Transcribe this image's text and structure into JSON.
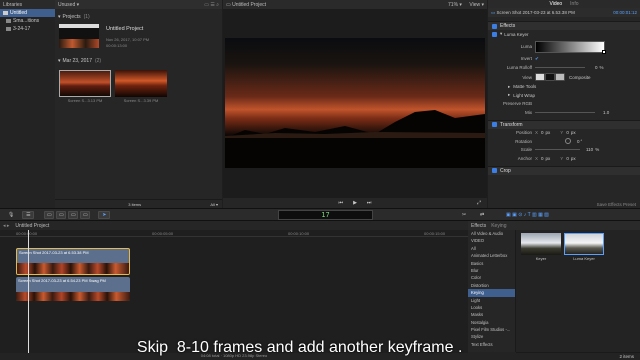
{
  "libraries": {
    "header": "Libraries",
    "items": [
      {
        "label": "Untitled",
        "selected": true
      },
      {
        "label": "Sma...itions"
      },
      {
        "label": "3-24-17"
      }
    ]
  },
  "browser": {
    "filter": "Unused",
    "projects_label": "Projects",
    "projects_count": "(1)",
    "project_title": "Untitled Project",
    "project_date": "Nov 26, 2017, 10:07 PM",
    "project_duration": "00:00:13:00",
    "event_label": "Mar 23, 2017",
    "event_count": "(2)",
    "clip1_name": "Screen S...3.13 PM",
    "clip2_name": "Screen S...3.39 PM",
    "items_count": "3 items",
    "filter_all": "All"
  },
  "viewer": {
    "title": "Untitled Project",
    "zoom": "71%",
    "view_menu": "View"
  },
  "inspector": {
    "tabs": [
      "Video",
      "Info"
    ],
    "clip_name": "Screen Shot 2017-03-23 at 6.53.38 PM",
    "timecode": "00:00:01:12",
    "effects_label": "Effects",
    "luma_keyer": "Luma Keyer",
    "luma_label": "Luma",
    "invert_label": "Invert",
    "luma_rolloff_label": "Luma Rolloff",
    "luma_rolloff_value": "0",
    "luma_rolloff_unit": "%",
    "view_label": "View",
    "view_mode": "Composite",
    "matte_tools": "Matte Tools",
    "light_wrap": "Light Wrap",
    "preserve_rgb": "Preserve RGB",
    "mix_label": "Mix",
    "mix_value": "1.0",
    "transform_label": "Transform",
    "position_label": "Position",
    "position_x_label": "X",
    "position_x": "0",
    "position_x_unit": "px",
    "position_y_label": "Y",
    "position_y": "0",
    "position_y_unit": "px",
    "rotation_label": "Rotation",
    "rotation_value": "0",
    "rotation_unit": "°",
    "scale_label": "Scale",
    "scale_value": "110",
    "scale_unit": "%",
    "anchor_label": "Anchor",
    "anchor_x_label": "X",
    "anchor_x": "0",
    "anchor_x_unit": "px",
    "anchor_y_label": "Y",
    "anchor_y": "0",
    "anchor_y_unit": "px",
    "crop_label": "Crop",
    "save_preset": "Save Effects Preset"
  },
  "timeline": {
    "project": "Untitled Project",
    "timecode_display": "17",
    "ruler_times": [
      "00:00:00:00",
      "00:00:05:00",
      "00:00:10:00",
      "00:00:15:00"
    ],
    "clip_top_name": "Screen Shot 2017-03-23 at 6.53.38 PM",
    "clip_bottom_name": "Screen Shot 2017-03-23 at 6.54.23 PM Swag PM",
    "status": "04:08 total · 1080p HD 23.98p Stereo"
  },
  "effects_browser": {
    "tabs": [
      "Effects",
      "Keying"
    ],
    "list": [
      "All Video & Audio",
      "VIDEO",
      "All",
      "Animated Letterbox",
      "Basics",
      "Blur",
      "Color",
      "Distortion",
      "Keying",
      "Light",
      "Looks",
      "Masks",
      "Nostalgia",
      "Pixel Film Studios -...",
      "Stylize",
      "Text Effects"
    ],
    "selected_index": 8,
    "thumbs": [
      {
        "label": "Keyer"
      },
      {
        "label": "Luma Keyer"
      }
    ],
    "items_count": "2 items"
  },
  "caption": "Skip  8-10 frames and add another keyframe ."
}
